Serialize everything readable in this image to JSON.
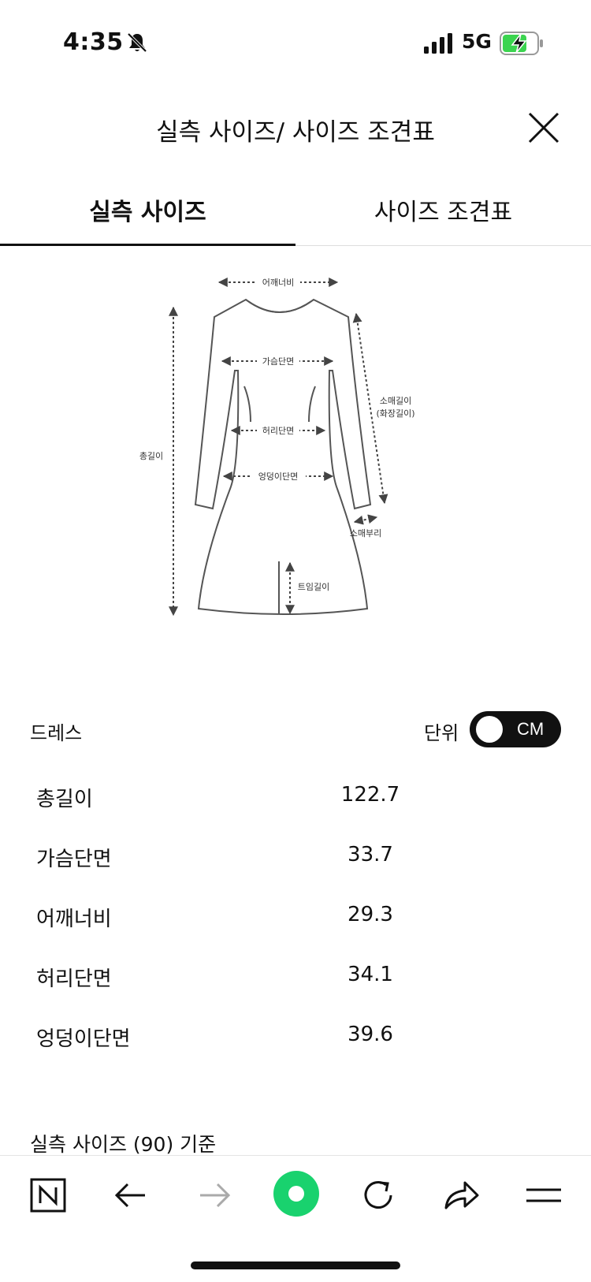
{
  "status_bar": {
    "time": "4:35",
    "network": "5G"
  },
  "header": {
    "title": "실측 사이즈/ 사이즈 조견표"
  },
  "tabs": [
    {
      "label": "실측 사이즈",
      "active": true
    },
    {
      "label": "사이즈 조견표",
      "active": false
    }
  ],
  "diagram": {
    "labels": {
      "shoulder": "어깨너비",
      "chest": "가슴단면",
      "waist": "허리단면",
      "hip": "엉덩이단면",
      "total_length": "총길이",
      "sleeve_line1": "소매길이",
      "sleeve_line2": "(화장길이)",
      "cuff": "소매부리",
      "slit": "트임길이"
    }
  },
  "section": {
    "title": "드레스",
    "unit_label": "단위",
    "unit_value": "CM"
  },
  "measurements": [
    {
      "name": "총길이",
      "value": "122.7"
    },
    {
      "name": "가슴단면",
      "value": "33.7"
    },
    {
      "name": "어깨너비",
      "value": "29.3"
    },
    {
      "name": "허리단면",
      "value": "34.1"
    },
    {
      "name": "엉덩이단면",
      "value": "39.6"
    }
  ],
  "note": "실측 사이즈 (90) 기준",
  "colors": {
    "accent_green": "#19d26e",
    "battery_green": "#3bd44f"
  },
  "toolbar_icons": [
    "naver-icon",
    "back-arrow-icon",
    "forward-arrow-icon",
    "green-dot-icon",
    "refresh-icon",
    "share-icon",
    "menu-icon"
  ]
}
